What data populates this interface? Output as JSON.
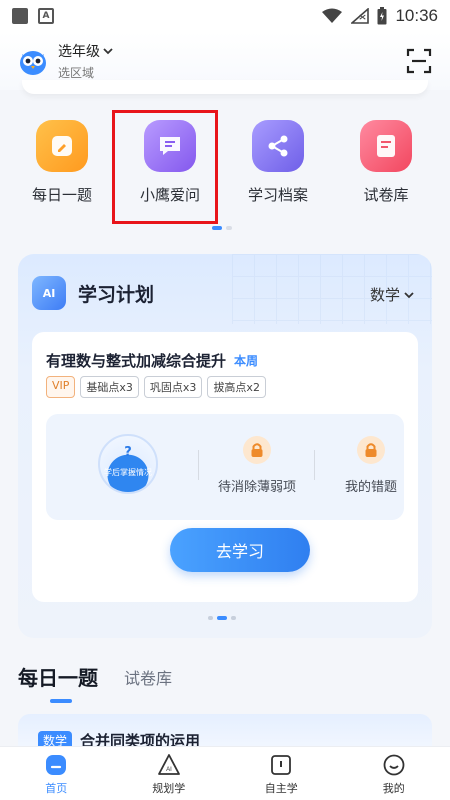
{
  "status_bar": {
    "time": "10:36",
    "notification_icon": "A"
  },
  "header": {
    "grade": "选年级",
    "region": "选区域"
  },
  "quick_actions": [
    {
      "label": "每日一题",
      "icon": "pencil-icon",
      "color": "#ffa52e"
    },
    {
      "label": "小鹰爱问",
      "icon": "chat-icon",
      "color": "#9a6cf0"
    },
    {
      "label": "学习档案",
      "icon": "share-icon",
      "color": "#8a6cf0"
    },
    {
      "label": "试卷库",
      "icon": "paper-icon",
      "color": "#f45a72"
    }
  ],
  "plan": {
    "badge": "AI",
    "title": "学习计划",
    "subject": "数学",
    "card": {
      "title": "有理数与整式加减综合提升",
      "week": "本周",
      "tags": [
        "VIP",
        "基础点x3",
        "巩固点x3",
        "拔高点x2"
      ],
      "globe_mark": "?",
      "globe_label": "学后掌握情况",
      "stat1": "待消除薄弱项",
      "stat2": "我的错题",
      "button": "去学习"
    }
  },
  "section_tabs": {
    "active": "每日一题",
    "other": "试卷库"
  },
  "question_card": {
    "tag": "数学",
    "title": "合并同类项的运用"
  },
  "bottom_nav": [
    {
      "label": "首页",
      "active": true
    },
    {
      "label": "规划学",
      "active": false
    },
    {
      "label": "自主学",
      "active": false
    },
    {
      "label": "我的",
      "active": false
    }
  ]
}
